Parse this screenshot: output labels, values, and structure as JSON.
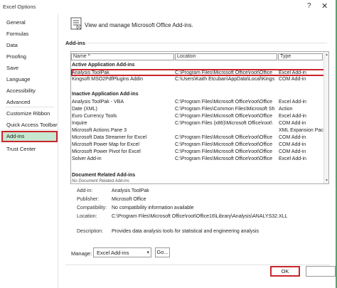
{
  "window": {
    "title": "Excel Options",
    "help_glyph": "?",
    "close_glyph": "✕"
  },
  "nav": {
    "items": [
      {
        "label": "General"
      },
      {
        "label": "Formulas"
      },
      {
        "label": "Data"
      },
      {
        "label": "Proofing"
      },
      {
        "label": "Save"
      },
      {
        "label": "Language"
      },
      {
        "label": "Accessibility"
      },
      {
        "label": "Advanced"
      },
      {
        "label": "Customize Ribbon"
      },
      {
        "label": "Quick Access Toolbar"
      },
      {
        "label": "Add-ins"
      },
      {
        "label": "Trust Center"
      }
    ],
    "selected": "Add-ins"
  },
  "header": {
    "icon": "addins-icon",
    "text": "View and manage Microsoft Office Add-ins."
  },
  "section_title": "Add-ins",
  "table": {
    "columns": [
      "Name ^",
      "Location",
      "Type"
    ],
    "groups": [
      {
        "title": "Active Application Add-ins",
        "rows": [
          {
            "name": "Analysis ToolPak",
            "location": "C:\\Program Files\\Microsoft Office\\root\\Office",
            "type": "Excel Add-in"
          },
          {
            "name": "Kingsoft MSO2PdfPlugins Addin",
            "location": "C:\\Users\\Kaith Etcuban\\AppData\\Local\\Kings",
            "type": "COM Add-in"
          }
        ]
      },
      {
        "title": "Inactive Application Add-ins",
        "rows": [
          {
            "name": "Analysis ToolPak - VBA",
            "location": "C:\\Program Files\\Microsoft Office\\root\\Office",
            "type": "Excel Add-in"
          },
          {
            "name": "Date (XML)",
            "location": "C:\\Program Files\\Common Files\\Microsoft Sh",
            "type": "Action"
          },
          {
            "name": "Euro Currency Tools",
            "location": "C:\\Program Files\\Microsoft Office\\root\\Office",
            "type": "Excel Add-in"
          },
          {
            "name": "Inquire",
            "location": "C:\\Program Files (x86)\\Microsoft Office\\root\\",
            "type": "COM Add-in"
          },
          {
            "name": "Microsoft Actions Pane 3",
            "location": "",
            "type": "XML Expansion Pack"
          },
          {
            "name": "Microsoft Data Streamer for Excel",
            "location": "C:\\Program Files\\Microsoft Office\\root\\Office",
            "type": "COM Add-in"
          },
          {
            "name": "Microsoft Power Map for Excel",
            "location": "C:\\Program Files\\Microsoft Office\\root\\Office",
            "type": "COM Add-in"
          },
          {
            "name": "Microsoft Power Pivot for Excel",
            "location": "C:\\Program Files\\Microsoft Office\\root\\Office",
            "type": "COM Add-in"
          },
          {
            "name": "Solver Add-in",
            "location": "C:\\Program Files\\Microsoft Office\\root\\Office",
            "type": "Excel Add-in"
          }
        ]
      },
      {
        "title": "Document Related Add-ins",
        "none_text": "No Document Related Add-ins"
      }
    ],
    "selected_row": "Analysis ToolPak"
  },
  "details": [
    {
      "label": "Add-in:",
      "value": "Analysis ToolPak"
    },
    {
      "label": "Publisher:",
      "value": "Microsoft Office"
    },
    {
      "label": "Compatibility:",
      "value": "No compatibility information available"
    },
    {
      "label": "Location:",
      "value": "C:\\Program Files\\Microsoft Office\\root\\Office16\\Library\\Analysis\\ANALYS32.XLL"
    },
    {
      "label": "Description:",
      "value": "Provides data analysis tools for statistical and engineering analysis"
    }
  ],
  "manage": {
    "label": "Manage:",
    "selected": "Excel Add-ins",
    "go_label": "Go..."
  },
  "buttons": {
    "ok": "OK",
    "cancel": ""
  },
  "colors": {
    "selection_highlight": "#c9252b",
    "nav_selected_bg": "#c6e7d0",
    "accent_green": "#57a36e"
  }
}
